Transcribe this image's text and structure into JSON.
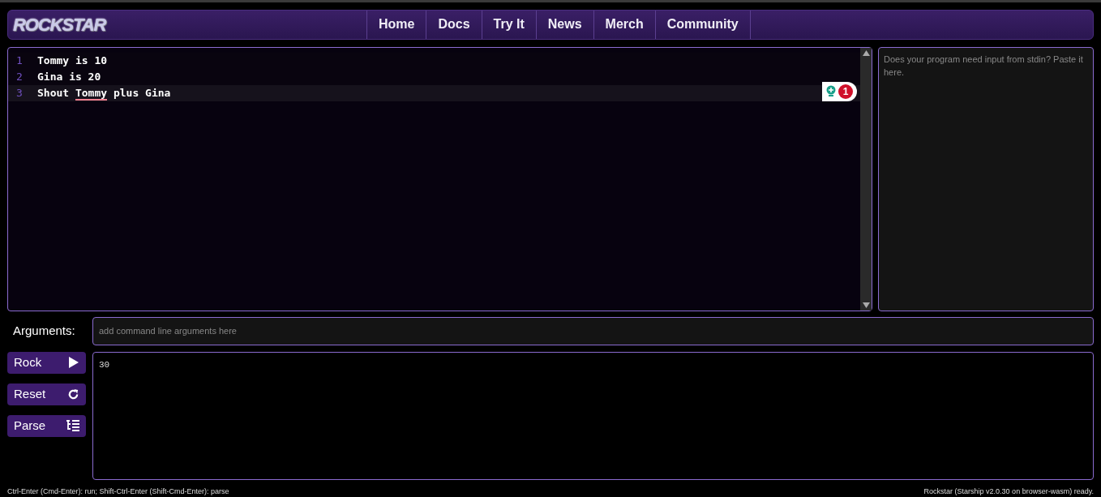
{
  "logo": "ROCKSTAR",
  "nav": [
    {
      "label": "Home"
    },
    {
      "label": "Docs"
    },
    {
      "label": "Try It"
    },
    {
      "label": "News"
    },
    {
      "label": "Merch"
    },
    {
      "label": "Community"
    }
  ],
  "editor": {
    "lines": [
      {
        "number": "1",
        "active": false,
        "segments": [
          {
            "text": "Tommy is 10",
            "error": false
          }
        ]
      },
      {
        "number": "2",
        "active": false,
        "segments": [
          {
            "text": "Gina is 20",
            "error": false
          }
        ]
      },
      {
        "number": "3",
        "active": true,
        "segments": [
          {
            "text": "Shout ",
            "error": false
          },
          {
            "text": "Tommy",
            "error": true
          },
          {
            "text": " plus Gina",
            "error": false
          }
        ]
      }
    ],
    "problem_count": "1"
  },
  "stdin": {
    "placeholder": "Does your program need input from stdin? Paste it here."
  },
  "arguments": {
    "label": "Arguments:",
    "placeholder": "add command line arguments here"
  },
  "buttons": [
    {
      "label": "Rock",
      "kind": "run"
    },
    {
      "label": "Reset",
      "kind": "reset"
    },
    {
      "label": "Parse",
      "kind": "parse"
    }
  ],
  "output": "30",
  "status_bar": {
    "hint": "Ctrl-Enter (Cmd-Enter): run; Shift-Ctrl-Enter (Shift-Cmd-Enter): parse",
    "status": "Rockstar (Starship v2.0.30 on browser-wasm) ready."
  }
}
